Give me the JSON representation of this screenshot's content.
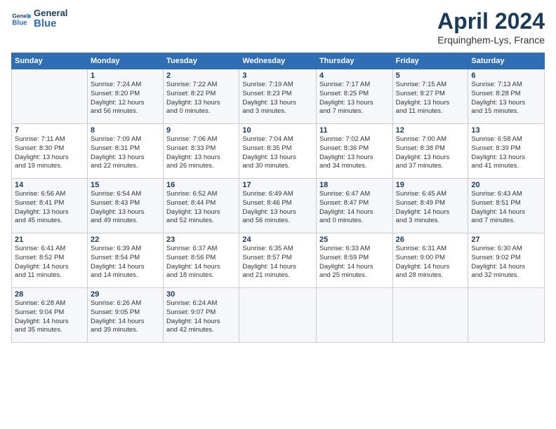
{
  "header": {
    "logo_line1": "General",
    "logo_line2": "Blue",
    "title": "April 2024",
    "subtitle": "Erquinghem-Lys, France"
  },
  "columns": [
    "Sunday",
    "Monday",
    "Tuesday",
    "Wednesday",
    "Thursday",
    "Friday",
    "Saturday"
  ],
  "weeks": [
    [
      {
        "day": "",
        "info": ""
      },
      {
        "day": "1",
        "info": "Sunrise: 7:24 AM\nSunset: 8:20 PM\nDaylight: 12 hours\nand 56 minutes."
      },
      {
        "day": "2",
        "info": "Sunrise: 7:22 AM\nSunset: 8:22 PM\nDaylight: 13 hours\nand 0 minutes."
      },
      {
        "day": "3",
        "info": "Sunrise: 7:19 AM\nSunset: 8:23 PM\nDaylight: 13 hours\nand 3 minutes."
      },
      {
        "day": "4",
        "info": "Sunrise: 7:17 AM\nSunset: 8:25 PM\nDaylight: 13 hours\nand 7 minutes."
      },
      {
        "day": "5",
        "info": "Sunrise: 7:15 AM\nSunset: 8:27 PM\nDaylight: 13 hours\nand 11 minutes."
      },
      {
        "day": "6",
        "info": "Sunrise: 7:13 AM\nSunset: 8:28 PM\nDaylight: 13 hours\nand 15 minutes."
      }
    ],
    [
      {
        "day": "7",
        "info": "Sunrise: 7:11 AM\nSunset: 8:30 PM\nDaylight: 13 hours\nand 19 minutes."
      },
      {
        "day": "8",
        "info": "Sunrise: 7:09 AM\nSunset: 8:31 PM\nDaylight: 13 hours\nand 22 minutes."
      },
      {
        "day": "9",
        "info": "Sunrise: 7:06 AM\nSunset: 8:33 PM\nDaylight: 13 hours\nand 26 minutes."
      },
      {
        "day": "10",
        "info": "Sunrise: 7:04 AM\nSunset: 8:35 PM\nDaylight: 13 hours\nand 30 minutes."
      },
      {
        "day": "11",
        "info": "Sunrise: 7:02 AM\nSunset: 8:36 PM\nDaylight: 13 hours\nand 34 minutes."
      },
      {
        "day": "12",
        "info": "Sunrise: 7:00 AM\nSunset: 8:38 PM\nDaylight: 13 hours\nand 37 minutes."
      },
      {
        "day": "13",
        "info": "Sunrise: 6:58 AM\nSunset: 8:39 PM\nDaylight: 13 hours\nand 41 minutes."
      }
    ],
    [
      {
        "day": "14",
        "info": "Sunrise: 6:56 AM\nSunset: 8:41 PM\nDaylight: 13 hours\nand 45 minutes."
      },
      {
        "day": "15",
        "info": "Sunrise: 6:54 AM\nSunset: 8:43 PM\nDaylight: 13 hours\nand 49 minutes."
      },
      {
        "day": "16",
        "info": "Sunrise: 6:52 AM\nSunset: 8:44 PM\nDaylight: 13 hours\nand 52 minutes."
      },
      {
        "day": "17",
        "info": "Sunrise: 6:49 AM\nSunset: 8:46 PM\nDaylight: 13 hours\nand 56 minutes."
      },
      {
        "day": "18",
        "info": "Sunrise: 6:47 AM\nSunset: 8:47 PM\nDaylight: 14 hours\nand 0 minutes."
      },
      {
        "day": "19",
        "info": "Sunrise: 6:45 AM\nSunset: 8:49 PM\nDaylight: 14 hours\nand 3 minutes."
      },
      {
        "day": "20",
        "info": "Sunrise: 6:43 AM\nSunset: 8:51 PM\nDaylight: 14 hours\nand 7 minutes."
      }
    ],
    [
      {
        "day": "21",
        "info": "Sunrise: 6:41 AM\nSunset: 8:52 PM\nDaylight: 14 hours\nand 11 minutes."
      },
      {
        "day": "22",
        "info": "Sunrise: 6:39 AM\nSunset: 8:54 PM\nDaylight: 14 hours\nand 14 minutes."
      },
      {
        "day": "23",
        "info": "Sunrise: 6:37 AM\nSunset: 8:56 PM\nDaylight: 14 hours\nand 18 minutes."
      },
      {
        "day": "24",
        "info": "Sunrise: 6:35 AM\nSunset: 8:57 PM\nDaylight: 14 hours\nand 21 minutes."
      },
      {
        "day": "25",
        "info": "Sunrise: 6:33 AM\nSunset: 8:59 PM\nDaylight: 14 hours\nand 25 minutes."
      },
      {
        "day": "26",
        "info": "Sunrise: 6:31 AM\nSunset: 9:00 PM\nDaylight: 14 hours\nand 28 minutes."
      },
      {
        "day": "27",
        "info": "Sunrise: 6:30 AM\nSunset: 9:02 PM\nDaylight: 14 hours\nand 32 minutes."
      }
    ],
    [
      {
        "day": "28",
        "info": "Sunrise: 6:28 AM\nSunset: 9:04 PM\nDaylight: 14 hours\nand 35 minutes."
      },
      {
        "day": "29",
        "info": "Sunrise: 6:26 AM\nSunset: 9:05 PM\nDaylight: 14 hours\nand 39 minutes."
      },
      {
        "day": "30",
        "info": "Sunrise: 6:24 AM\nSunset: 9:07 PM\nDaylight: 14 hours\nand 42 minutes."
      },
      {
        "day": "",
        "info": ""
      },
      {
        "day": "",
        "info": ""
      },
      {
        "day": "",
        "info": ""
      },
      {
        "day": "",
        "info": ""
      }
    ]
  ]
}
